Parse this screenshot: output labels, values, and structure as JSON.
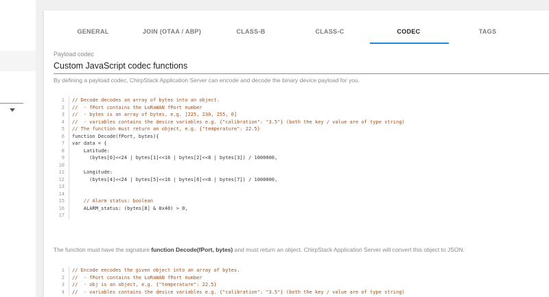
{
  "tabs": [
    {
      "label": "GENERAL"
    },
    {
      "label": "JOIN (OTAA / ABP)"
    },
    {
      "label": "CLASS-B"
    },
    {
      "label": "CLASS-C"
    },
    {
      "label": "CODEC"
    },
    {
      "label": "TAGS"
    }
  ],
  "active_tab": "CODEC",
  "payload_codec": {
    "label": "Payload codec",
    "value": "Custom JavaScript codec functions",
    "helper": "By defining a payload codec, ChirpStack Application Server can encode and decode the binary device payload for you."
  },
  "decode_code": [
    {
      "n": "1",
      "t": "// Decode decodes an array of bytes into an object."
    },
    {
      "n": "2",
      "t": "//  - fPort contains the LoRaWAN fPort number"
    },
    {
      "n": "3",
      "t": "//  - bytes is an array of bytes, e.g. [225, 230, 255, 0]"
    },
    {
      "n": "4",
      "t": "//  - variables contains the device variables e.g. {\"calibration\": \"3.5\"} (both the key / value are of type string)"
    },
    {
      "n": "5",
      "t": "// The function must return an object, e.g. {\"temperature\": 22.5}"
    },
    {
      "n": "6",
      "t": "function Decode(fPort, bytes){"
    },
    {
      "n": "7",
      "t": "var data = {"
    },
    {
      "n": "8",
      "t": "    Latitude:"
    },
    {
      "n": "9",
      "t": "      (bytes[0]<<24 | bytes[1]<<16 | bytes[2]<<8 | bytes[3]) / 1000000,"
    },
    {
      "n": "10",
      "t": ""
    },
    {
      "n": "11",
      "t": "    Longitude:"
    },
    {
      "n": "12",
      "t": "      (bytes[4]<<24 | bytes[5]<<16 | bytes[6]<<8 | bytes[7]) / 1000000,"
    },
    {
      "n": "13",
      "t": ""
    },
    {
      "n": "14",
      "t": ""
    },
    {
      "n": "15",
      "t": "    // Alarm status: boolean"
    },
    {
      "n": "16",
      "t": "    ALARM_status: (bytes[8] & 0x40) > 0,"
    },
    {
      "n": "17",
      "t": ""
    }
  ],
  "decode_desc": {
    "before": "The function must have the signature ",
    "bold": "function Decode(fPort, bytes)",
    "after": " and must return an object. ChirpStack Application Server will convert this object to JSON."
  },
  "encode_code": [
    {
      "n": "1",
      "t": "// Encode encodes the given object into an array of bytes."
    },
    {
      "n": "2",
      "t": "//  - fPort contains the LoRaWAN fPort number"
    },
    {
      "n": "3",
      "t": "//  - obj is an object, e.g. {\"temperature\": 22.5}"
    },
    {
      "n": "4",
      "t": "//  - variables contains the device variables e.g. {\"calibration\": \"3.5\"} (both the key / value are of type string)"
    }
  ],
  "colors": {
    "accent": "#1e88e5",
    "comment": "#a0501e"
  }
}
